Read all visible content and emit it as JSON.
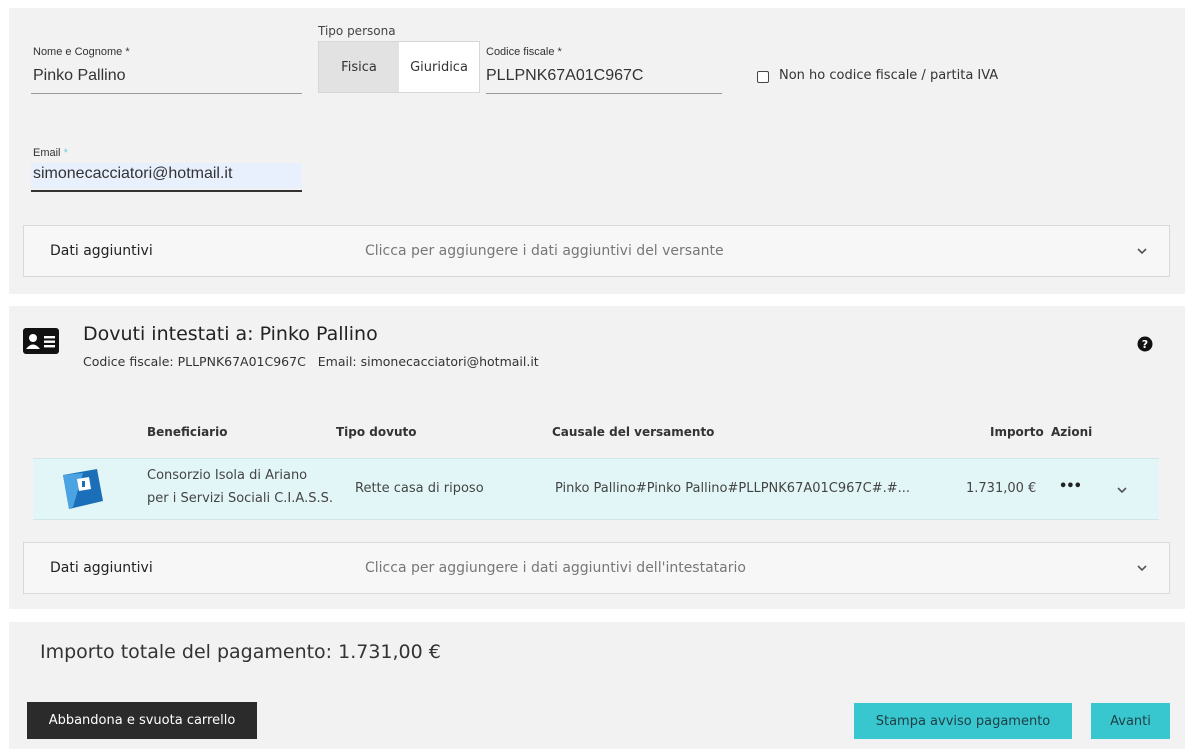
{
  "versante": {
    "nome": {
      "label": "Nome e Cognome",
      "required_mark": "*",
      "value": "Pinko Pallino"
    },
    "tipo_persona": {
      "label": "Tipo persona",
      "options": [
        "Fisica",
        "Giuridica"
      ],
      "selected": "Fisica"
    },
    "codice_fiscale": {
      "label": "Codice fiscale",
      "required_mark": "*",
      "value": "PLLPNK67A01C967C"
    },
    "no_cf": {
      "label": "Non ho codice fiscale / partita IVA",
      "checked": false
    },
    "email": {
      "label": "Email",
      "required_mark": "*",
      "value": "simonecacciatori@hotmail.it"
    },
    "dati_aggiuntivi": {
      "title": "Dati aggiuntivi",
      "hint": "Clicca per aggiungere i dati aggiuntivi del versante"
    }
  },
  "dovuti": {
    "title": "Dovuti intestati a: Pinko Pallino",
    "codice_fiscale_text": "Codice fiscale: PLLPNK67A01C967C",
    "email_text": "Email: simonecacciatori@hotmail.it",
    "columns": {
      "beneficiario": "Beneficiario",
      "tipo": "Tipo dovuto",
      "causale": "Causale del versamento",
      "importo": "Importo",
      "azioni": "Azioni"
    },
    "rows": [
      {
        "beneficiario_line1": "Consorzio Isola di Ariano",
        "beneficiario_line2": "per i Servizi Sociali C.I.A.S.S.",
        "tipo": "Rette casa di riposo",
        "causale": "Pinko Pallino#Pinko Pallino#PLLPNK67A01C967C#.#...",
        "importo": "1.731,00 €",
        "azioni": "•••"
      }
    ],
    "dati_aggiuntivi": {
      "title": "Dati aggiuntivi",
      "hint": "Clicca per aggiungere i dati aggiuntivi dell'intestatario"
    }
  },
  "totale": {
    "label": "Importo totale del pagamento: 1.731,00 €",
    "abbandona_label": "Abbandona e svuota carrello",
    "stampa_label": "Stampa avviso pagamento",
    "avanti_label": "Avanti"
  },
  "icons": {
    "card": "id-card-icon",
    "help": "help-circle-icon",
    "chevron": "chevron-down-icon",
    "logo": "beneficiary-logo"
  },
  "colors": {
    "accent": "#38c6cf",
    "row_highlight": "#e3f6f7",
    "dark_button": "#2b2b2b",
    "panel_bg": "#f2f2f2"
  }
}
